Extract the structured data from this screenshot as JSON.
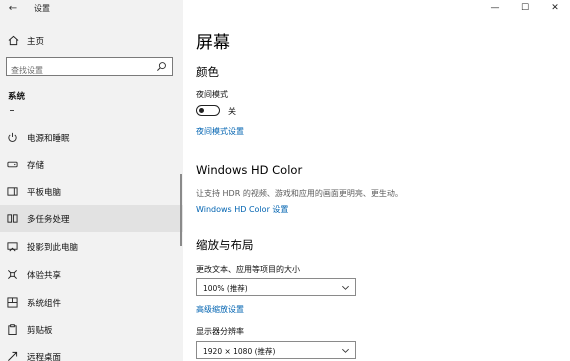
{
  "window": {
    "title": "设置",
    "back_glyph": "←",
    "minimize_glyph": "—",
    "maximize_glyph": "☐",
    "close_glyph": "✕"
  },
  "sidebar": {
    "home_label": "主页",
    "search_placeholder": "查找设置",
    "section_title": "系统",
    "items": [
      {
        "label": "电源和睡眠",
        "icon": "power-icon"
      },
      {
        "label": "存储",
        "icon": "storage-icon"
      },
      {
        "label": "平板电脑",
        "icon": "tablet-icon"
      },
      {
        "label": "多任务处理",
        "icon": "multitasking-icon"
      },
      {
        "label": "投影到此电脑",
        "icon": "projecting-icon"
      },
      {
        "label": "体验共享",
        "icon": "shared-experiences-icon"
      },
      {
        "label": "系统组件",
        "icon": "system-components-icon"
      },
      {
        "label": "剪贴板",
        "icon": "clipboard-icon"
      },
      {
        "label": "远程桌面",
        "icon": "remote-desktop-icon"
      }
    ]
  },
  "main": {
    "page_title": "屏幕",
    "color_section": {
      "title": "颜色",
      "night_light_label": "夜间模式",
      "toggle_state": "关",
      "night_light_settings_link": "夜间模式设置"
    },
    "hd_color_section": {
      "title": "Windows HD Color",
      "description": "让支持 HDR 的视频、游戏和应用的画面更明亮、更生动。",
      "settings_link": "Windows HD Color 设置"
    },
    "scale_layout_section": {
      "title": "缩放与布局",
      "scale_label": "更改文本、应用等项目的大小",
      "scale_value": "100% (推荐)",
      "advanced_scaling_link": "高级缩放设置",
      "resolution_label": "显示器分辨率",
      "resolution_value": "1920 × 1080 (推荐)"
    }
  }
}
